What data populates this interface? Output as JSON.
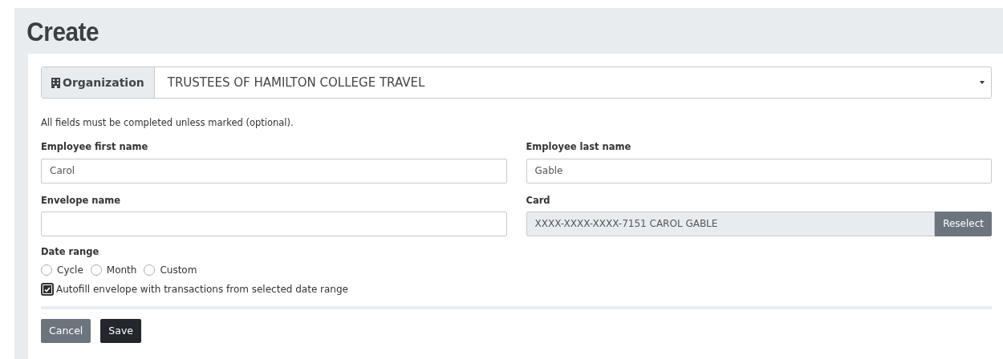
{
  "page_title": "Create",
  "organization": {
    "label": "Organization",
    "value": "TRUSTEES OF HAMILTON COLLEGE TRAVEL"
  },
  "note": "All fields must be completed unless marked (optional).",
  "fields": [
    {
      "label": "Employee first name",
      "value": "Carol",
      "kind": "text"
    },
    {
      "label": "Employee last name",
      "value": "Gable",
      "kind": "text"
    },
    {
      "label": "Envelope name",
      "kind": "text"
    },
    {
      "label": "Card",
      "value": "XXXX-XXXX-XXXX-7151 CAROL GABLE",
      "kind": "readonly",
      "button": "Reselect"
    }
  ],
  "date_range": {
    "label": "Date range",
    "options": [
      {
        "label": "Cycle",
        "selected": false
      },
      {
        "label": "Month",
        "selected": false
      },
      {
        "label": "Custom",
        "selected": false
      }
    ]
  },
  "autofill": {
    "label": "Autofill envelope with transactions from selected date range",
    "checked": true
  },
  "buttons": [
    {
      "label": "Cancel",
      "kind": "secondary"
    },
    {
      "label": "Save",
      "kind": "primary"
    }
  ]
}
